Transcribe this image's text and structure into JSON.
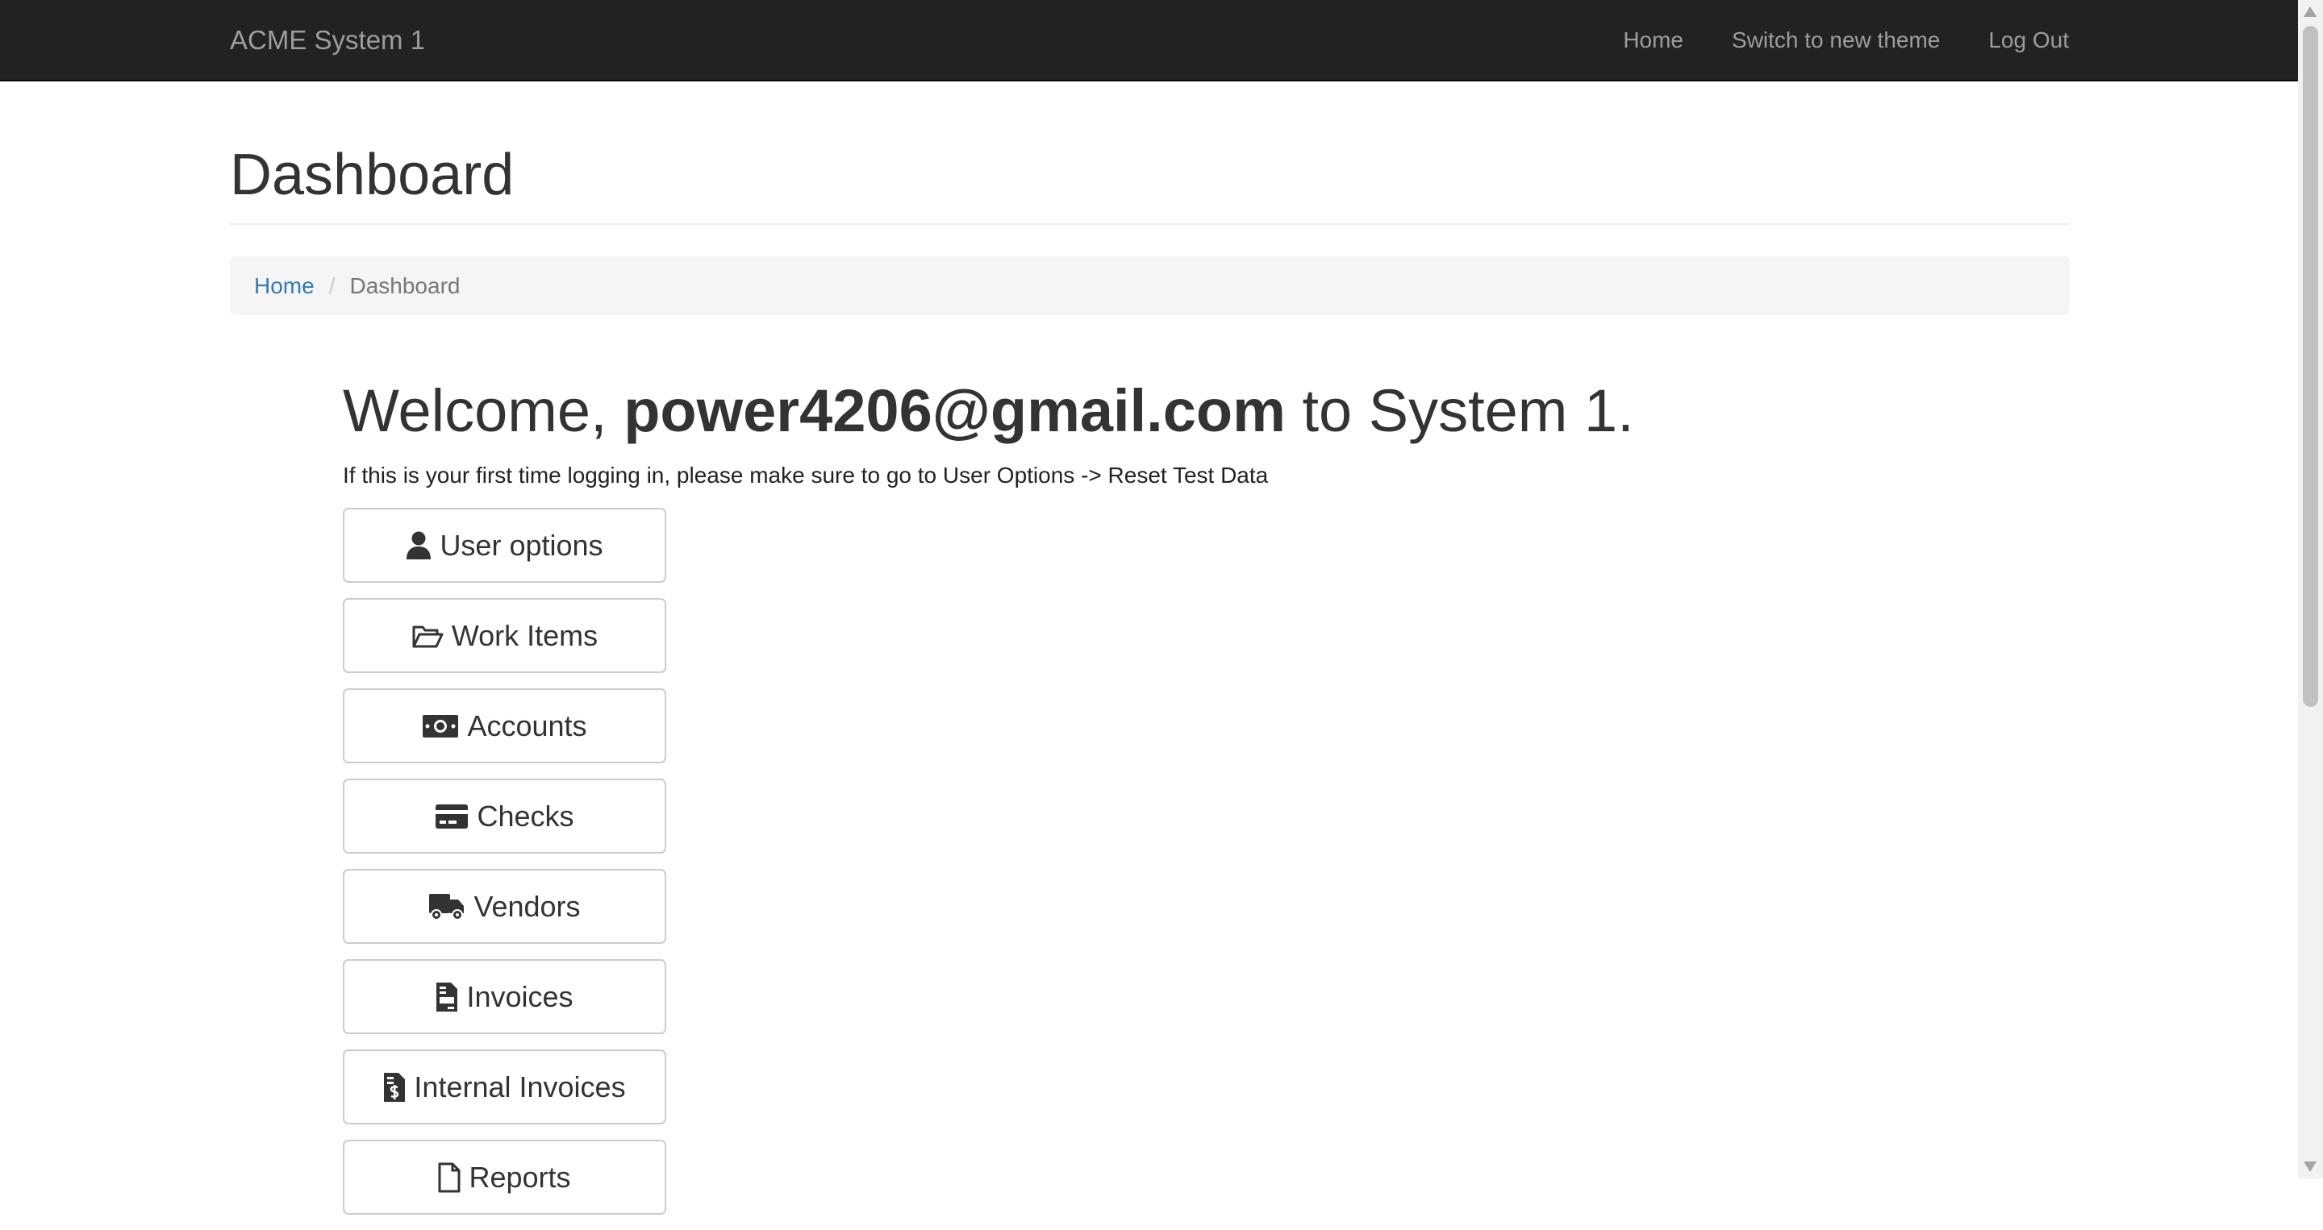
{
  "navbar": {
    "brand": "ACME System 1",
    "links": [
      "Home",
      "Switch to new theme",
      "Log Out"
    ]
  },
  "page": {
    "title": "Dashboard"
  },
  "breadcrumb": {
    "home": "Home",
    "separator": "/",
    "current": "Dashboard"
  },
  "welcome": {
    "prefix": "Welcome,",
    "email": "power4206@gmail.com",
    "suffix": "to System 1.",
    "hint": "If this is your first time logging in, please make sure to go to User Options -> Reset Test Data"
  },
  "menu": [
    {
      "label": "User options",
      "icon": "user-icon"
    },
    {
      "label": "Work Items",
      "icon": "folder-open-icon"
    },
    {
      "label": "Accounts",
      "icon": "money-bill-icon"
    },
    {
      "label": "Checks",
      "icon": "credit-card-icon"
    },
    {
      "label": "Vendors",
      "icon": "truck-icon"
    },
    {
      "label": "Invoices",
      "icon": "file-invoice-icon"
    },
    {
      "label": "Internal Invoices",
      "icon": "file-invoice-dollar-icon"
    },
    {
      "label": "Reports",
      "icon": "file-icon"
    }
  ],
  "colors": {
    "navbar_bg": "#222222",
    "navbar_text": "#9d9d9d",
    "link": "#337ab7",
    "breadcrumb_bg": "#f5f5f5"
  }
}
